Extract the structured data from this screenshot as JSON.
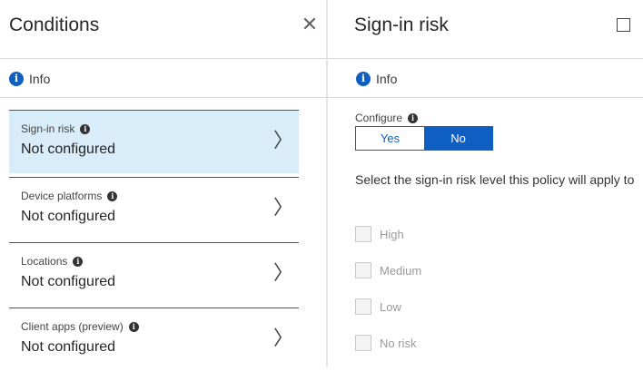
{
  "left": {
    "title": "Conditions",
    "close_glyph": "✕",
    "info_label": "Info",
    "items": [
      {
        "label": "Sign-in risk",
        "value": "Not configured",
        "selected": true
      },
      {
        "label": "Device platforms",
        "value": "Not configured",
        "selected": false
      },
      {
        "label": "Locations",
        "value": "Not configured",
        "selected": false
      },
      {
        "label": "Client apps (preview)",
        "value": "Not configured",
        "selected": false
      }
    ]
  },
  "right": {
    "title": "Sign-in risk",
    "info_label": "Info",
    "configure_label": "Configure",
    "toggle": {
      "yes": "Yes",
      "no": "No",
      "selected": "No"
    },
    "description": "Select the sign-in risk level this policy will apply to",
    "risk_levels": [
      {
        "label": "High",
        "checked": false
      },
      {
        "label": "Medium",
        "checked": false
      },
      {
        "label": "Low",
        "checked": false
      },
      {
        "label": "No risk",
        "checked": false
      }
    ]
  },
  "colors": {
    "accent": "#0f5fc2",
    "selected_bg": "#d8ecfa"
  }
}
